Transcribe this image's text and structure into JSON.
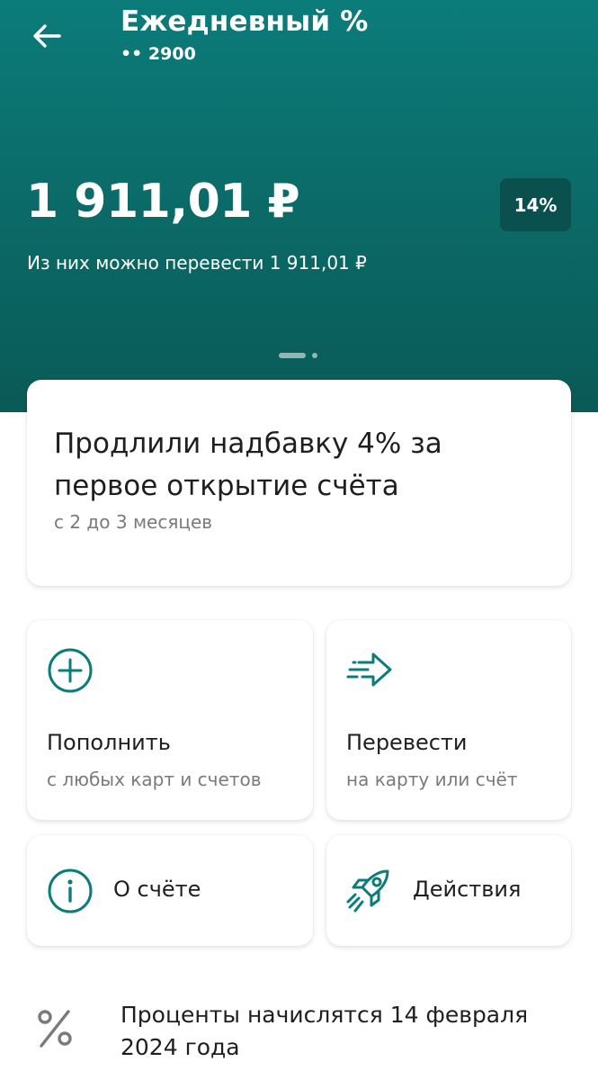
{
  "header": {
    "title": "Ежедневный %",
    "account_mask": "•• 2900",
    "balance": "1 911,01 ₽",
    "rate_badge": "14%",
    "available_text": "Из них можно перевести 1 911,01 ₽"
  },
  "promo": {
    "title": "Продлили надбавку 4% за первое открытие счёта",
    "subtitle": "с 2 до 3 месяцев"
  },
  "actions": [
    {
      "label": "Пополнить",
      "subtitle": "с любых карт и счетов",
      "icon": "plus-circle-icon"
    },
    {
      "label": "Перевести",
      "subtitle": "на карту или счёт",
      "icon": "send-arrow-icon"
    },
    {
      "label": "О счёте",
      "icon": "info-circle-icon"
    },
    {
      "label": "Действия",
      "icon": "rocket-icon"
    }
  ],
  "interest_note": {
    "text": "Проценты начислятся 14 февраля 2024 года",
    "icon": "percent-icon"
  },
  "colors": {
    "header_top": "#0b7c7a",
    "header_bottom": "#0a5a57",
    "accent": "#0b7c7a"
  }
}
